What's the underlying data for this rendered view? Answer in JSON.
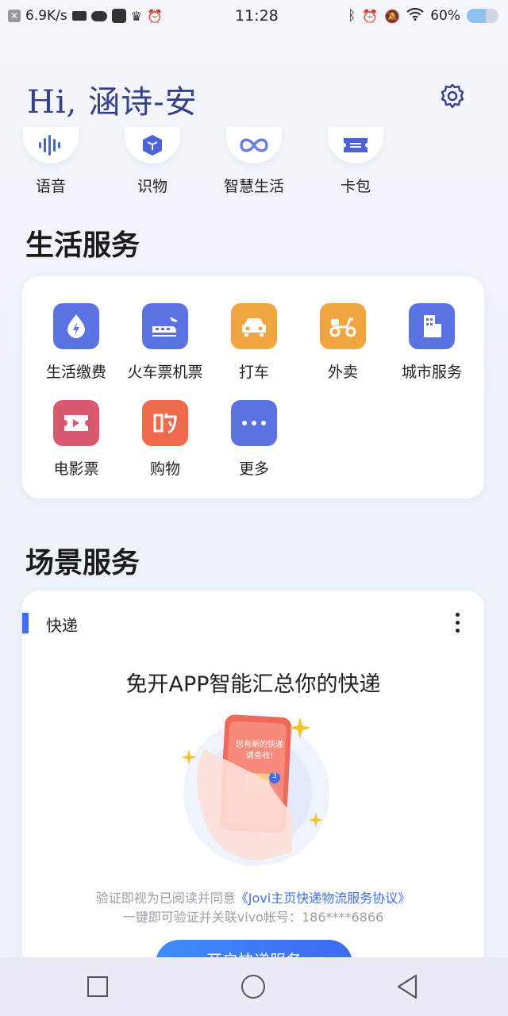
{
  "status": {
    "speed": "6.9K/s",
    "time": "11:28",
    "battery_text": "60%",
    "battery_level": 0.6
  },
  "header": {
    "greeting": "Hi, 涵诗-安"
  },
  "quick": [
    {
      "label": "语音",
      "icon": "voice-wave-icon"
    },
    {
      "label": "识物",
      "icon": "cube-icon"
    },
    {
      "label": "智慧生活",
      "icon": "infinity-icon"
    },
    {
      "label": "卡包",
      "icon": "ticket-icon"
    }
  ],
  "life": {
    "title": "生活服务",
    "items": [
      {
        "label": "生活缴费",
        "icon": "water-bolt-icon",
        "color": "#5b73e0"
      },
      {
        "label": "火车票机票",
        "icon": "train-plane-icon",
        "color": "#5b73e0"
      },
      {
        "label": "打车",
        "icon": "car-icon",
        "color": "#f0a640"
      },
      {
        "label": "外卖",
        "icon": "scooter-icon",
        "color": "#f0a640"
      },
      {
        "label": "城市服务",
        "icon": "building-icon",
        "color": "#5b73e0"
      },
      {
        "label": "电影票",
        "icon": "movie-ticket-icon",
        "color": "#d85a6e"
      },
      {
        "label": "购物",
        "icon": "shopping-icon",
        "color": "#ef6a4a"
      },
      {
        "label": "更多",
        "icon": "more-dots-icon",
        "color": "#5b73e0"
      }
    ]
  },
  "scene": {
    "title": "场景服务",
    "card_title": "快递",
    "promo": "免开APP智能汇总你的快递",
    "phone_text": "您有新的快递请查收!",
    "badge": "3",
    "agree_prefix": "验证即视为已阅读并同意",
    "agree_link": "《Jovi主页快递物流服务协议》",
    "agree_line2": "一键即可验证并关联vivo帐号：186****6866",
    "cta": "开启快递服务"
  },
  "colors": {
    "accent": "#3f6df5",
    "greeting": "#34408a"
  }
}
